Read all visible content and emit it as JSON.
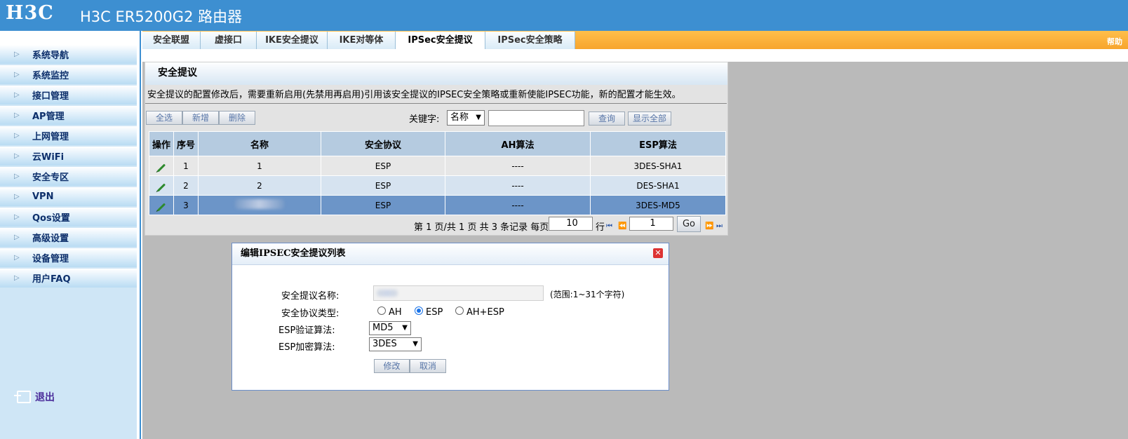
{
  "header": {
    "logo": "H3C",
    "title": "H3C ER5200G2 路由器"
  },
  "sidebar": {
    "items": [
      {
        "label": "系统导航"
      },
      {
        "label": "系统监控"
      },
      {
        "label": "接口管理"
      },
      {
        "label": "AP管理"
      },
      {
        "label": "上网管理"
      },
      {
        "label": "云WiFi"
      },
      {
        "label": "安全专区"
      },
      {
        "label": "VPN"
      },
      {
        "label": "Qos设置"
      },
      {
        "label": "高级设置"
      },
      {
        "label": "设备管理"
      },
      {
        "label": "用户FAQ"
      }
    ],
    "logout": "退出"
  },
  "tabs": {
    "items": [
      {
        "label": "安全联盟"
      },
      {
        "label": "虚接口"
      },
      {
        "label": "IKE安全提议"
      },
      {
        "label": "IKE对等体"
      },
      {
        "label": "IPSec安全提议"
      },
      {
        "label": "IPSec安全策略"
      }
    ],
    "active_index": 4,
    "help": "帮助"
  },
  "panel": {
    "title": "安全提议",
    "notice": "安全提议的配置修改后，需要重新启用(先禁用再启用)引用该安全提议的IPSEC安全策略或重新使能IPSEC功能，新的配置才能生效。",
    "buttons": {
      "select_all": "全选",
      "add": "新增",
      "delete": "删除"
    },
    "search": {
      "label": "关键字:",
      "field": "名称",
      "value": "",
      "query": "查询",
      "show_all": "显示全部"
    },
    "table": {
      "headers": [
        "操作",
        "序号",
        "名称",
        "安全协议",
        "AH算法",
        "ESP算法"
      ],
      "rows": [
        {
          "no": "1",
          "name": "1",
          "protocol": "ESP",
          "ah": "----",
          "esp": "3DES-SHA1"
        },
        {
          "no": "2",
          "name": "2",
          "protocol": "ESP",
          "ah": "----",
          "esp": "DES-SHA1"
        },
        {
          "no": "3",
          "name": "",
          "protocol": "ESP",
          "ah": "----",
          "esp": "3DES-MD5"
        }
      ]
    },
    "pager": {
      "summary": "第 1 页/共 1 页 共 3 条记录 每页",
      "per_page": "10",
      "row_unit": "行",
      "page": "1",
      "go": "Go"
    }
  },
  "dialog": {
    "title": "编辑IPSEC安全提议列表",
    "name_label": "安全提议名称:",
    "name_value": "",
    "name_hint": "(范围:1~31个字符)",
    "protocol_label": "安全协议类型:",
    "protocol_options": [
      "AH",
      "ESP",
      "AH+ESP"
    ],
    "protocol_selected": "ESP",
    "auth_label": "ESP验证算法:",
    "auth_value": "MD5",
    "enc_label": "ESP加密算法:",
    "enc_value": "3DES",
    "modify": "修改",
    "cancel": "取消"
  }
}
